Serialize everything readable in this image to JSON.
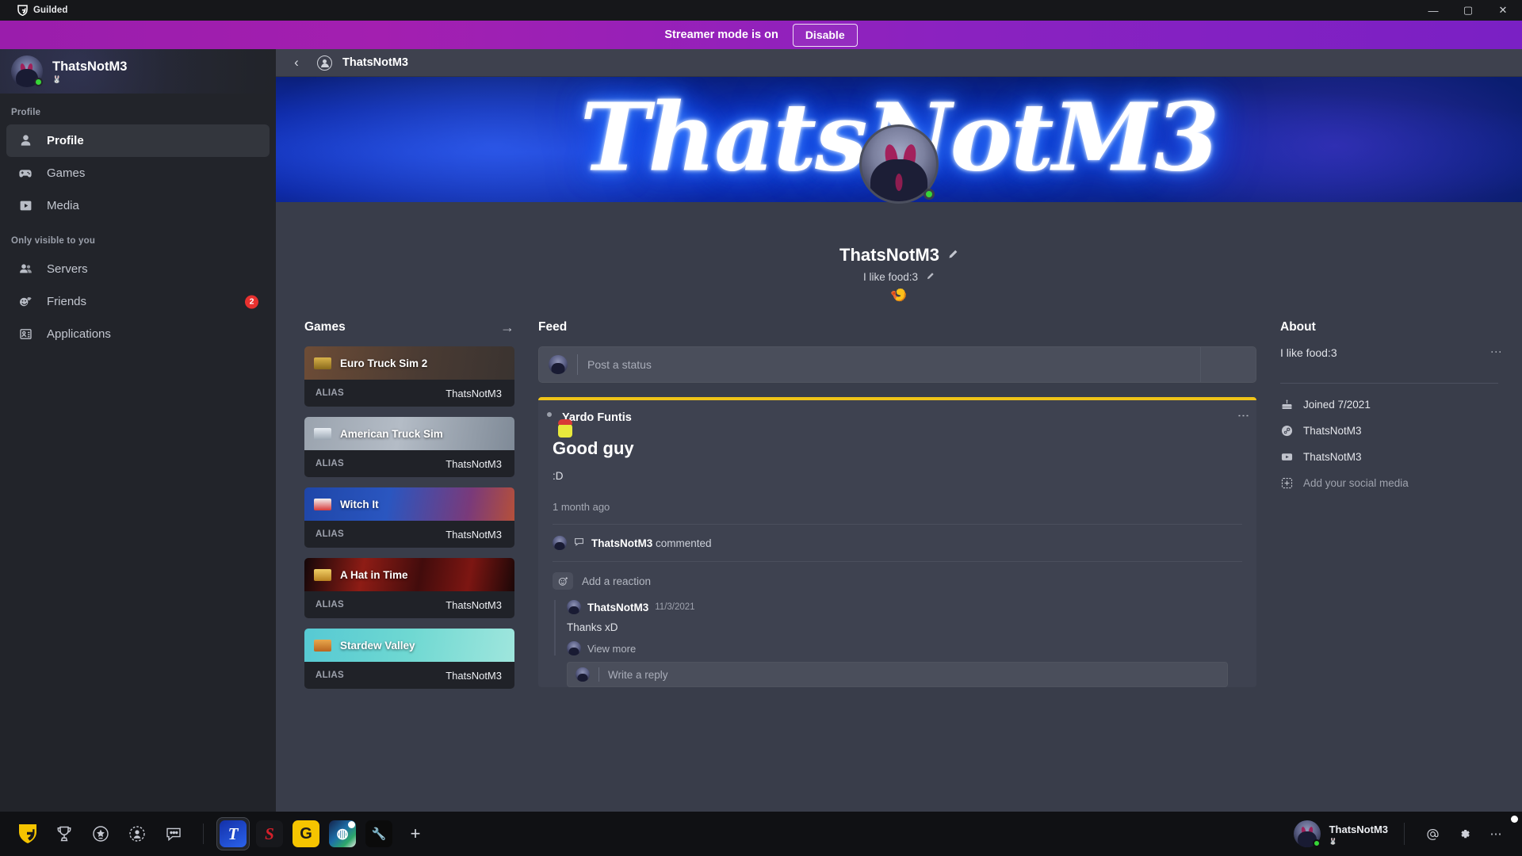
{
  "window": {
    "app_title": "Guilded",
    "logo_icon": "guilded-shield-icon",
    "controls": {
      "minimize": "—",
      "maximize": "▢",
      "close": "✕"
    }
  },
  "streamer_banner": {
    "message": "Streamer mode is on",
    "disable_label": "Disable",
    "accent": "#8b22c0"
  },
  "sidebar": {
    "user": {
      "name": "ThatsNotM3",
      "status": "online",
      "status_color": "#37d638",
      "sub_emoji": "🐰"
    },
    "sections": [
      {
        "label": "Profile",
        "items": [
          {
            "label": "Profile",
            "icon": "person-icon",
            "active": true
          },
          {
            "label": "Games",
            "icon": "gamepad-icon",
            "active": false
          },
          {
            "label": "Media",
            "icon": "play-box-icon",
            "active": false
          }
        ]
      },
      {
        "label": "Only visible to you",
        "items": [
          {
            "label": "Servers",
            "icon": "people-icon",
            "active": false,
            "badge": ""
          },
          {
            "label": "Friends",
            "icon": "friends-icon",
            "active": false,
            "badge": "2"
          },
          {
            "label": "Applications",
            "icon": "id-card-icon",
            "active": false,
            "badge": ""
          }
        ]
      }
    ]
  },
  "breadcrumb": {
    "back_icon": "chevron-left-icon",
    "profile_icon": "person-circle-icon",
    "title": "ThatsNotM3"
  },
  "profile": {
    "banner_text": "ThatsNotM3",
    "name": "ThatsNotM3",
    "edit_icon": "pencil-icon",
    "tagline": "I like food:3",
    "tagline_edit_icon": "pencil-small-icon",
    "badge_emoji": "🍤",
    "status_color": "#37d638"
  },
  "games": {
    "heading": "Games",
    "arrow_icon": "arrow-right-icon",
    "alias_label": "ALIAS",
    "items": [
      {
        "name": "Euro Truck Sim 2",
        "alias": "ThatsNotM3",
        "banner_color": "#5a4236",
        "icon_color": "#c9a227"
      },
      {
        "name": "American Truck Sim",
        "alias": "ThatsNotM3",
        "banner_color": "#8e97a3",
        "icon_color": "#dde3ea"
      },
      {
        "name": "Witch It",
        "alias": "ThatsNotM3",
        "banner_color": "#1c3f8e",
        "icon_color": "#e23b4a"
      },
      {
        "name": "A Hat in Time",
        "alias": "ThatsNotM3",
        "banner_color": "#6e1414",
        "icon_color": "#e8c24a"
      },
      {
        "name": "Stardew Valley",
        "alias": "ThatsNotM3",
        "banner_color": "#61d2d6",
        "icon_color": "#d8872c"
      }
    ]
  },
  "feed": {
    "heading": "Feed",
    "post_placeholder": "Post a status",
    "post": {
      "author": "Yardo Funtis",
      "author_status": "idle",
      "title": "Good guy",
      "body": ":D",
      "timestamp": "1 month ago",
      "kebab_icon": "more-vertical-icon",
      "accent_bar": "#f0c419",
      "comment_summary_user": "ThatsNotM3",
      "comment_summary_suffix": " commented",
      "comment_icon": "comment-bubble-icon",
      "add_reaction_label": "Add a reaction",
      "add_reaction_icon": "emoji-plus-icon",
      "reply": {
        "author": "ThatsNotM3",
        "date": "11/3/2021",
        "body": "Thanks xD",
        "view_more_label": "View more"
      },
      "reply_placeholder": "Write a reply"
    }
  },
  "about": {
    "heading": "About",
    "bio": "I like food:3",
    "kebab_icon": "more-vertical-icon",
    "entries": [
      {
        "label": "Joined 7/2021",
        "icon": "cake-icon",
        "muted": false
      },
      {
        "label": "ThatsNotM3",
        "icon": "steam-icon",
        "muted": false
      },
      {
        "label": "ThatsNotM3",
        "icon": "youtube-icon",
        "muted": false
      },
      {
        "label": "Add your social media",
        "icon": "plus-box-icon",
        "muted": true
      }
    ]
  },
  "taskbar": {
    "system_icons": [
      {
        "name": "guilded-logo-icon",
        "glyph": "G",
        "color": "#f5c400"
      },
      {
        "name": "trophy-icon",
        "glyph": "🏆",
        "color": "#c6c9d2"
      },
      {
        "name": "star-badge-icon",
        "glyph": "★",
        "color": "#c6c9d2"
      },
      {
        "name": "profile-circle-icon",
        "glyph": "◉",
        "color": "#c6c9d2"
      },
      {
        "name": "chat-bubble-icon",
        "glyph": "…",
        "color": "#c6c9d2"
      }
    ],
    "apps": [
      {
        "name": "teams-app",
        "glyph": "T",
        "bg": "#1b3fd1",
        "fg": "#ffffff",
        "active": true,
        "dot": false
      },
      {
        "name": "sublime-app",
        "glyph": "S",
        "bg": "#17181c",
        "fg": "#d6202b",
        "active": false,
        "dot": false
      },
      {
        "name": "guilded-app",
        "glyph": "G",
        "bg": "#f5c400",
        "fg": "#1a1a1a",
        "active": false,
        "dot": true
      },
      {
        "name": "browser-app",
        "glyph": "◍",
        "bg": "#1d2a4d",
        "fg": "#8fd6ff",
        "active": false,
        "dot": true
      },
      {
        "name": "tool-app",
        "glyph": "🔧",
        "bg": "#0d0d0d",
        "fg": "#c98b34",
        "active": false,
        "dot": false
      }
    ],
    "add_label": "+",
    "user": {
      "name": "ThatsNotM3",
      "status_color": "#37d638",
      "sub_emoji": "🐰"
    },
    "right_icons": [
      {
        "name": "mentions-icon",
        "glyph": "@"
      },
      {
        "name": "gear-icon",
        "glyph": "⚙"
      },
      {
        "name": "more-horizontal-icon",
        "glyph": "⋯"
      }
    ]
  }
}
